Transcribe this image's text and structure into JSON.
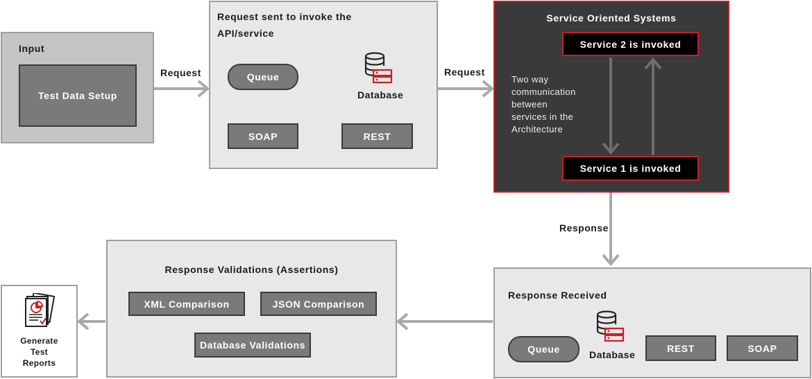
{
  "input_panel": {
    "title": "Input",
    "setup_label": "Test Data Setup"
  },
  "request_panel": {
    "title_line1": "Request sent to invoke the",
    "title_line2": "API/service",
    "queue": "Queue",
    "database": "Database",
    "soap": "SOAP",
    "rest": "REST"
  },
  "service_panel": {
    "title": "Service Oriented Systems",
    "service2": "Service 2 is invoked",
    "service1": "Service 1 is invoked",
    "note": [
      "Two way",
      "communication",
      "between",
      "services in the",
      "Architecture"
    ]
  },
  "response_panel": {
    "title": "Response Received",
    "queue": "Queue",
    "database": "Database",
    "rest": "REST",
    "soap": "SOAP"
  },
  "validation_panel": {
    "title": "Response Validations (Assertions)",
    "xml": "XML Comparison",
    "json": "JSON Comparison",
    "db": "Database Validations"
  },
  "report": {
    "lines": [
      "Generate",
      "Test",
      "Reports"
    ]
  },
  "arrows": {
    "request1": "Request",
    "request2": "Request",
    "response": "Response"
  },
  "colors": {
    "accent": "#c8202a",
    "panel": "#e8e8e8",
    "dark_panel": "#3b3a3b",
    "button": "#7a7a7a",
    "arrow": "#a9a9a9"
  }
}
